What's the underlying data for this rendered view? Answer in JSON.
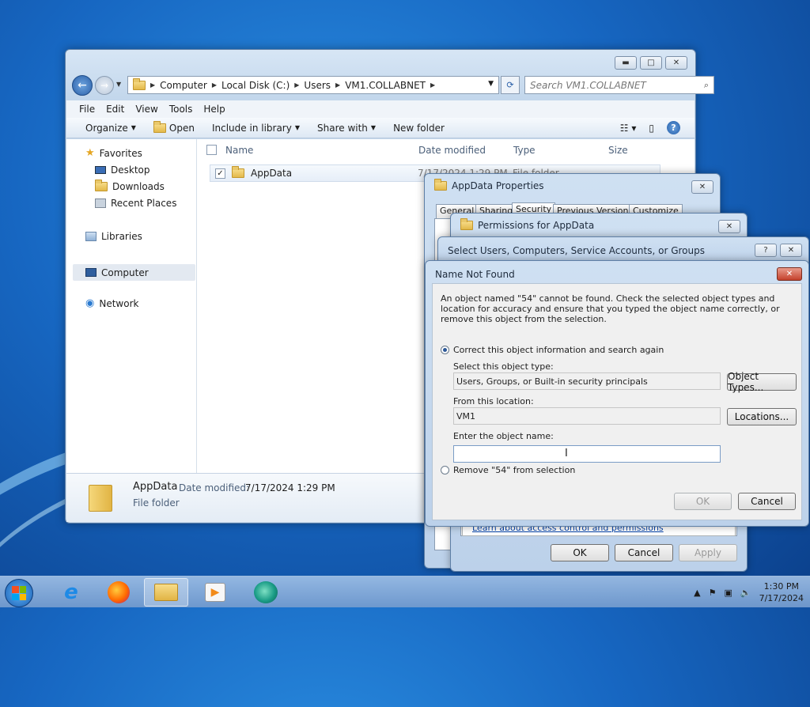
{
  "explorer": {
    "back_glyph": "←",
    "forward_glyph": "→",
    "breadcrumbs": [
      "Computer",
      "Local Disk (C:)",
      "Users",
      "VM1.COLLABNET"
    ],
    "search_placeholder": "Search VM1.COLLABNET",
    "menu": [
      "File",
      "Edit",
      "View",
      "Tools",
      "Help"
    ],
    "commands": {
      "organize": "Organize",
      "open": "Open",
      "include": "Include in library",
      "share": "Share with",
      "newfolder": "New folder"
    },
    "nav": {
      "favorites": "Favorites",
      "desktop": "Desktop",
      "downloads": "Downloads",
      "recent": "Recent Places",
      "libraries": "Libraries",
      "computer": "Computer",
      "network": "Network"
    },
    "columns": {
      "name": "Name",
      "date": "Date modified",
      "type": "Type",
      "size": "Size"
    },
    "row": {
      "name": "AppData",
      "date": "7/17/2024 1:29 PM",
      "type": "File folder"
    },
    "details": {
      "name": "AppData",
      "date_label": "Date modified:",
      "date": "7/17/2024 1:29 PM",
      "type": "File folder"
    }
  },
  "properties": {
    "title": "AppData Properties",
    "tabs": [
      "General",
      "Sharing",
      "Security",
      "Previous Versions",
      "Customize"
    ]
  },
  "permissions": {
    "title": "Permissions for AppData",
    "link": "Learn about access control and permissions",
    "ok": "OK",
    "cancel": "Cancel",
    "apply": "Apply"
  },
  "select_dialog": {
    "title": "Select Users, Computers, Service Accounts, or Groups"
  },
  "name_not_found": {
    "title": "Name Not Found",
    "message": "An object named \"54\" cannot be found. Check the selected object types and location for accuracy and ensure that you typed the object name correctly, or remove this object from the selection.",
    "option_correct": "Correct this object information and search again",
    "type_label": "Select this object type:",
    "type_value": "Users, Groups, or Built-in security principals",
    "object_types_btn": "Object Types...",
    "location_label": "From this location:",
    "location_value": "VM1",
    "locations_btn": "Locations...",
    "name_label": "Enter the object name:",
    "option_remove": "Remove \"54\" from selection",
    "ok": "OK",
    "cancel": "Cancel"
  },
  "taskbar": {
    "time": "1:30 PM",
    "date": "7/17/2024"
  }
}
